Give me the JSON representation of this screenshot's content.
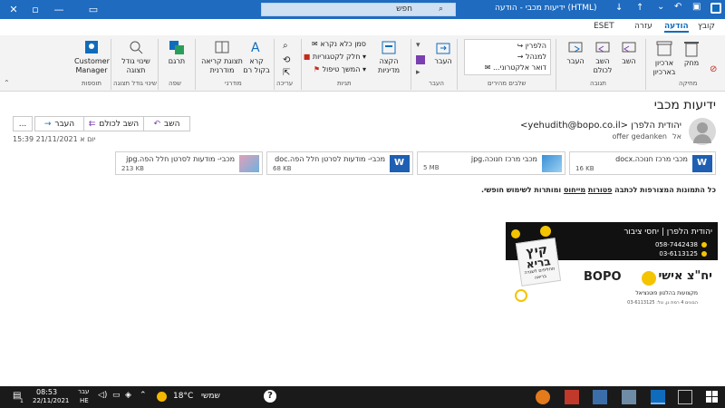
{
  "window": {
    "title": "ידיעות מכבי - הודעה (HTML)",
    "search_placeholder": "חפש"
  },
  "ribbon_tabs": {
    "file": "קובץ",
    "message": "הודעה",
    "help": "עזרה",
    "eset": "ESET"
  },
  "ribbon": {
    "groups": {
      "delete": "מחיקה",
      "respond": "תגובה",
      "quick_steps": "שלבים מהירים",
      "move": "העבר",
      "tags": "תגיות",
      "editing": "עריכה",
      "immersive": "מודרני",
      "speech": "שפה",
      "zoom": "שינוי גודל תצוגה",
      "addins": "תוספות"
    },
    "buttons": {
      "delete": "מחק",
      "archive": "ארכיון",
      "archive2": "בארכיון",
      "reply": "השב",
      "reply_all": "השב לכולם",
      "forward": "העבר",
      "quick1": "הלפרין",
      "quick2": "למנהל",
      "quick3": "דואר אלקטרוני...",
      "move": "העבר",
      "policy": "הקצה מדיניות",
      "mark_unread": "סמן כלא נקרא",
      "categorize": "חלק לקטגוריות",
      "followup": "המשך טיפול",
      "read_aloud": "קרא בקול רם",
      "immersive_reader": "תצוגת קריאה מודרנית",
      "translate": "תרגם",
      "zoom": "שינוי גודל תצוגה",
      "customer_manager": "Customer Manager"
    }
  },
  "message": {
    "subject": "ידיעות מכבי",
    "from": "יהודית הלפרן <yehudith@bopo.co.il>",
    "to_label": "אל",
    "to": "offer gedanken",
    "date": "יום א 21/11/2021 15:39",
    "actions": {
      "reply": "השב",
      "reply_all": "השב לכולם",
      "forward": "העבר",
      "more": "..."
    },
    "attachments": [
      {
        "name": "מכבי מרכז חנוכה.docx",
        "size": "16 KB",
        "type": "word"
      },
      {
        "name": "מכבי מרכז חנוכה.jpg",
        "size": "5 MB",
        "type": "image"
      },
      {
        "name": "מכבי- מודעות לסרטן חלל הפה.doc",
        "size": "68 KB",
        "type": "word"
      },
      {
        "name": "מכבי- מודעות לסרטן חלל הפה.jpg",
        "size": "213 KB",
        "type": "image"
      }
    ],
    "body": {
      "pre": "כל התמונות המצורפות לכתבה ",
      "u1": "פטורות",
      "mid1": " ",
      "u2": "מייחוס",
      "post": " ומותרות לשימוש חופשי."
    },
    "signature": {
      "name_line": "יהודית הלפרן | יחסי ציבור",
      "phone1": "058-7442438",
      "phone2": "03-6113125",
      "brand_pr": "יח\"צ אישי",
      "brand": "BOPO",
      "tagline": "מקצועות בהלטון פוטנציאל",
      "address": "הבונים 4 רמת גן, טל: 03-6113125",
      "promo1": "קיץ",
      "promo2": "בריא",
      "promo_sub": "תחליפים לשגרה בריאה"
    }
  },
  "taskbar": {
    "weather_temp": "18°C",
    "weather_label": "שמשי",
    "lang": "עבר",
    "lang2": "HE",
    "time": "08:53",
    "date": "22/11/2021",
    "notifications": "1"
  },
  "colors": {
    "titlebar": "#1e6bc0",
    "accent": "#0f6cbd",
    "taskbar": "#1a1a1a"
  }
}
